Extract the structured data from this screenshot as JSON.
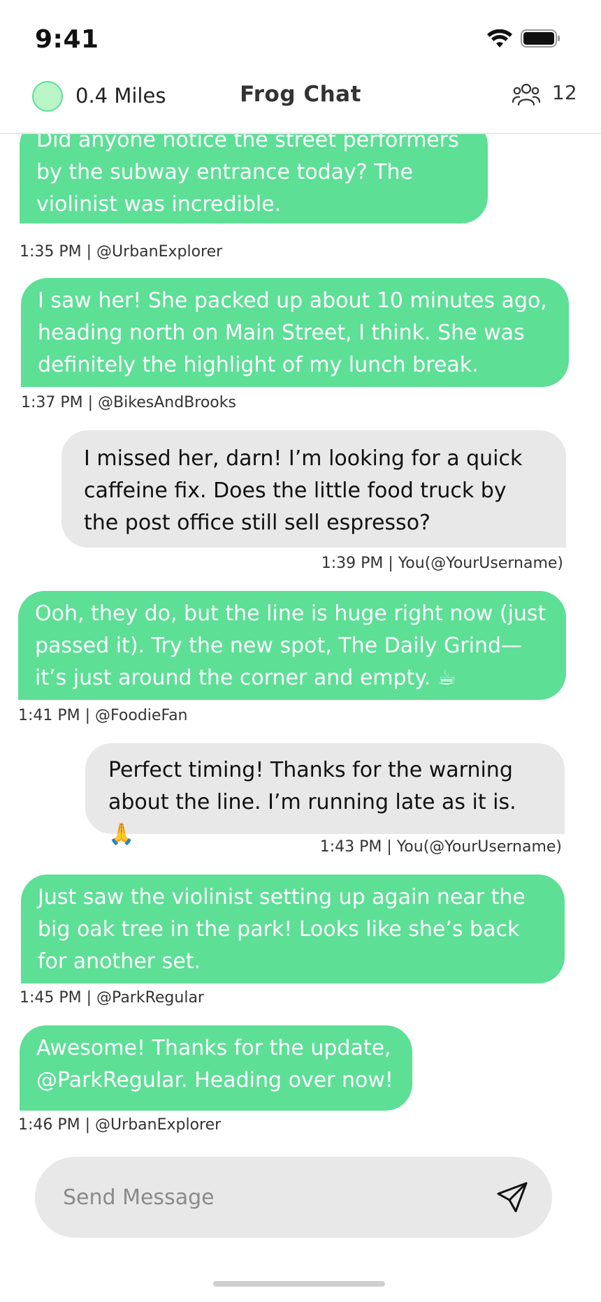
{
  "status_bar": {
    "time": "9:41"
  },
  "header": {
    "distance": "0.4 Miles",
    "title": "Frog Chat",
    "members_count": "12"
  },
  "messages": [
    {
      "text": "Did anyone notice the street performers by the subway entrance today? The violinist was incredible.",
      "meta": "1:35 PM | @UrbanExplorer",
      "own": false
    },
    {
      "text": "I saw her! She packed up about 10 minutes ago, heading north on Main Street, I think. She was definitely the highlight of my lunch break.",
      "meta": "1:37 PM | @BikesAndBrooks",
      "own": false
    },
    {
      "text": "I missed her, darn! I’m looking for a quick caffeine fix. Does the little food truck by the post office still sell espresso?",
      "meta": "1:39 PM | You(@YourUsername)",
      "own": true
    },
    {
      "text": "Ooh, they do, but the line is huge right now (just passed it). Try the new spot, The Daily Grind—it’s just around the corner and empty. ☕",
      "meta": "1:41 PM | @FoodieFan",
      "own": false
    },
    {
      "text": "Perfect timing! Thanks for the warning about the line. I’m running late as it is. 🙏",
      "meta": "1:43 PM | You(@YourUsername)",
      "own": true
    },
    {
      "text": "Just saw the violinist setting up again near the big oak tree in the park! Looks like she’s back for another set.",
      "meta": "1:45 PM | @ParkRegular",
      "own": false
    },
    {
      "text": "Awesome! Thanks for the update, @ParkRegular. Heading over now!",
      "meta": "1:46 PM | @UrbanExplorer",
      "own": false
    }
  ],
  "composer": {
    "placeholder": "Send Message"
  },
  "colors": {
    "accent": "#5ddf96",
    "own_bubble": "#e8e8e8"
  },
  "icons": {
    "distance": "status-dot-icon",
    "members": "people-icon",
    "send": "send-icon"
  }
}
